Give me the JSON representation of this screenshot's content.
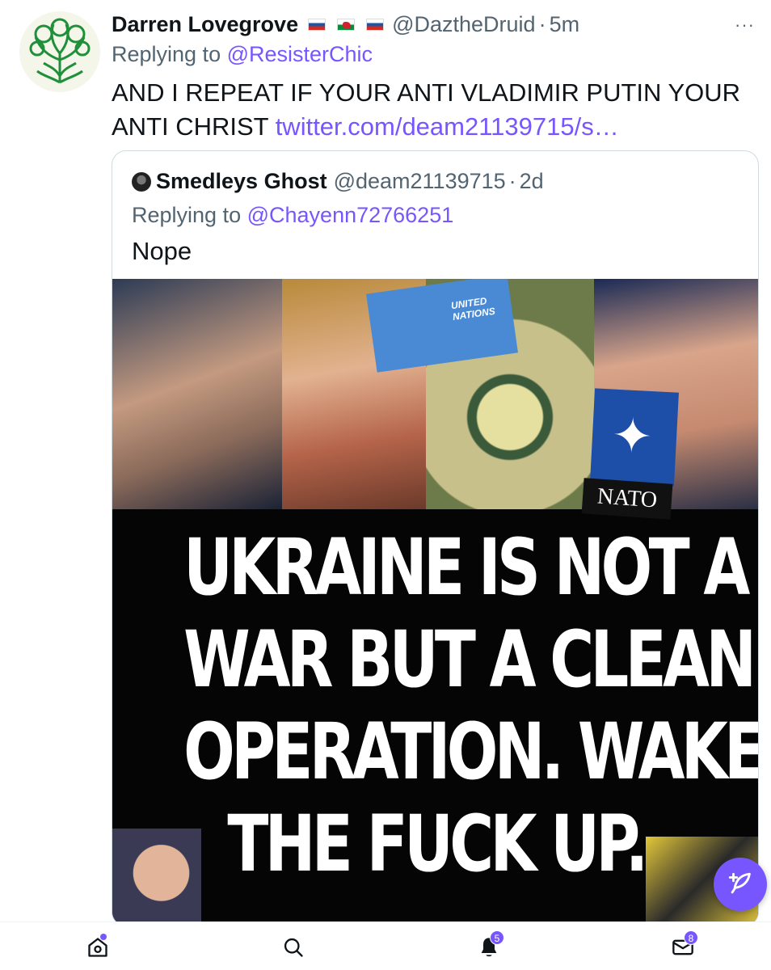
{
  "tweet": {
    "author_name": "Darren Lovegrove",
    "flag_icons": [
      "russia-flag-icon",
      "wales-flag-icon",
      "russia-flag-icon"
    ],
    "handle": "@DaztheDruid",
    "separator": "·",
    "time": "5m",
    "more_icon": "···",
    "replying_prefix": "Replying to",
    "replying_to": "@ResisterChic",
    "text_line1": "AND I REPEAT IF YOUR ANTI VLADIMIR PUTIN YOUR",
    "text_line2_prefix": "ANTI CHRIST",
    "link_text": "twitter.com/deam21139715/s…"
  },
  "quote": {
    "author_name": "Smedleys Ghost",
    "handle": "@deam21139715",
    "separator": "·",
    "time": "2d",
    "replying_prefix": "Replying to",
    "replying_to": "@Chayenn72766251",
    "text": "Nope",
    "media": {
      "badge_un": "UNITED NATIONS",
      "badge_nato": "NATO",
      "caption_lines": [
        "UKRAINE IS NOT A",
        "WAR BUT A CLEANUP",
        "OPERATION. WAKE",
        "THE FUCK UP."
      ]
    }
  },
  "compose_button_icon": "feather-plus-icon",
  "navbar": {
    "items": [
      {
        "icon": "home-icon",
        "badge": ""
      },
      {
        "icon": "search-icon",
        "badge": ""
      },
      {
        "icon": "bell-icon",
        "badge": "5"
      },
      {
        "icon": "mail-icon",
        "badge": "8"
      }
    ]
  },
  "colors": {
    "accent": "#7856ff",
    "text": "#0f1419",
    "secondary_text": "#536471",
    "border": "#cfd9de"
  }
}
